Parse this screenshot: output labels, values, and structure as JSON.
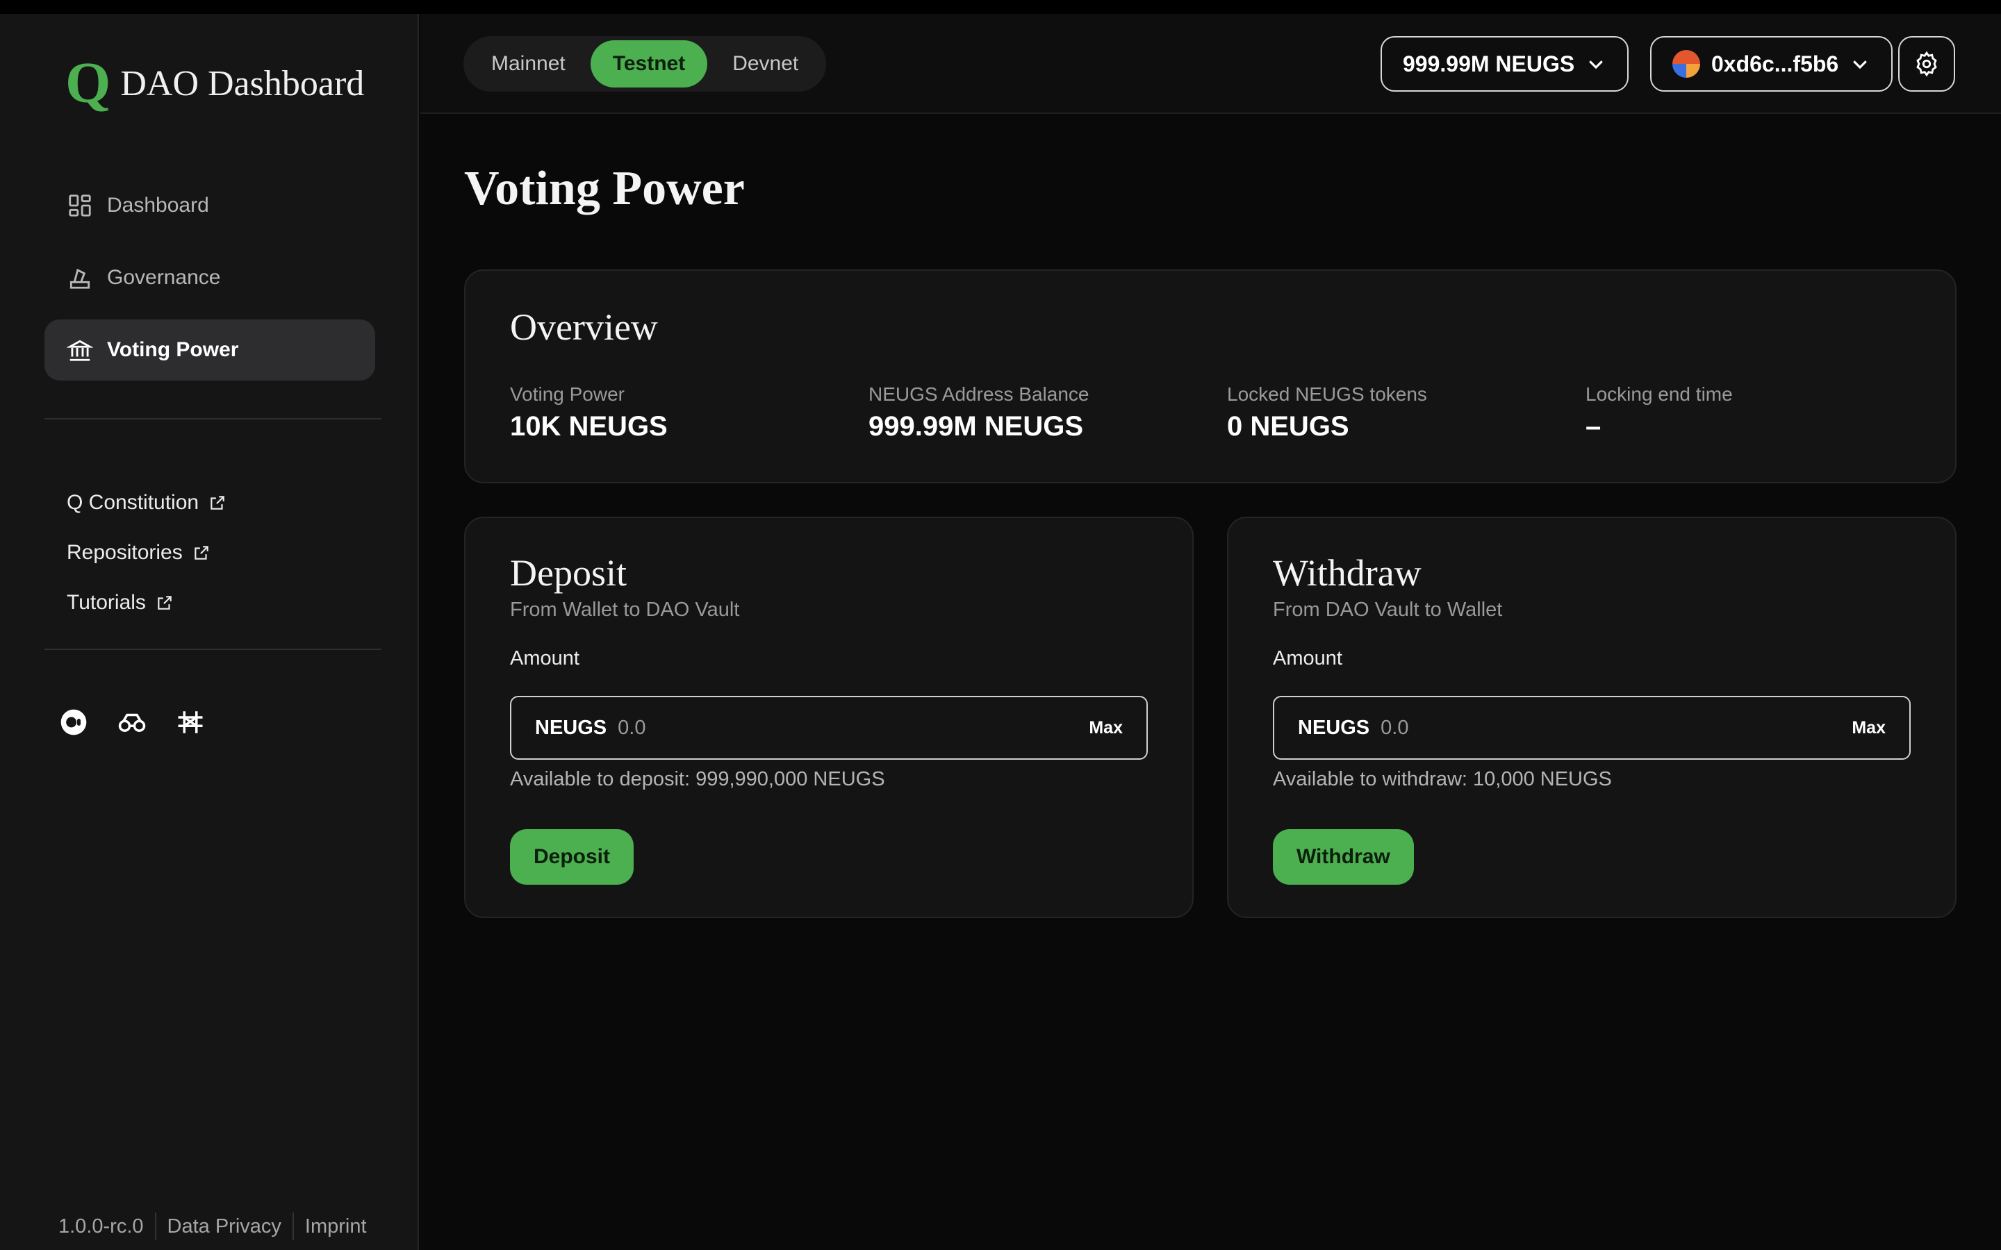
{
  "app": {
    "logo_letter": "Q",
    "title": "DAO Dashboard",
    "accent": "#4caf50"
  },
  "sidebar": {
    "items": [
      {
        "label": "Dashboard",
        "icon": "dashboard-grid-icon"
      },
      {
        "label": "Governance",
        "icon": "ballot-icon"
      },
      {
        "label": "Voting Power",
        "icon": "bank-icon",
        "active": true
      }
    ],
    "links": [
      {
        "label": "Q Constitution",
        "icon": "external-link-icon"
      },
      {
        "label": "Repositories",
        "icon": "external-link-icon"
      },
      {
        "label": "Tutorials",
        "icon": "external-link-icon"
      }
    ],
    "social_icons": [
      "medium-icon",
      "explorer-binoculars-icon",
      "bridge-icon"
    ],
    "footer": {
      "version": "1.0.0-rc.0",
      "privacy": "Data Privacy",
      "imprint": "Imprint"
    }
  },
  "header": {
    "networks": [
      "Mainnet",
      "Testnet",
      "Devnet"
    ],
    "active_network": "Testnet",
    "balance": "999.99M NEUGS",
    "account": "0xd6c...f5b6"
  },
  "page": {
    "title": "Voting Power"
  },
  "overview": {
    "title": "Overview",
    "stats": [
      {
        "label": "Voting Power",
        "value": "10K NEUGS"
      },
      {
        "label": "NEUGS Address Balance",
        "value": "999.99M NEUGS"
      },
      {
        "label": "Locked NEUGS tokens",
        "value": "0 NEUGS"
      },
      {
        "label": "Locking end time",
        "value": "–"
      }
    ]
  },
  "deposit": {
    "title": "Deposit",
    "subtitle": "From Wallet to DAO Vault",
    "amount_label": "Amount",
    "unit": "NEUGS",
    "placeholder": "0.0",
    "max_label": "Max",
    "available": "Available to deposit: 999,990,000 NEUGS",
    "button": "Deposit"
  },
  "withdraw": {
    "title": "Withdraw",
    "subtitle": "From DAO Vault to Wallet",
    "amount_label": "Amount",
    "unit": "NEUGS",
    "placeholder": "0.0",
    "max_label": "Max",
    "available": "Available to withdraw: 10,000 NEUGS",
    "button": "Withdraw"
  }
}
